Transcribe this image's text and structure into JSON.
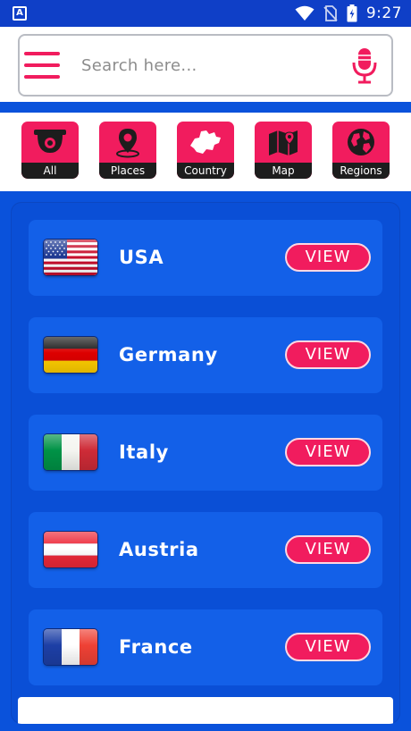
{
  "status_bar": {
    "app_badge": "A",
    "time": "9:27"
  },
  "search": {
    "placeholder": "Search here...",
    "value": ""
  },
  "categories": [
    {
      "label": "All",
      "icon": "cctv-camera-icon"
    },
    {
      "label": "Places",
      "icon": "map-pin-icon"
    },
    {
      "label": "Country",
      "icon": "country-shape-icon"
    },
    {
      "label": "Map",
      "icon": "folded-map-icon"
    },
    {
      "label": "Regions",
      "icon": "globe-icon"
    }
  ],
  "countries": [
    {
      "name": "USA",
      "flag": "us-flag",
      "action": "VIEW"
    },
    {
      "name": "Germany",
      "flag": "germany-flag",
      "action": "VIEW"
    },
    {
      "name": "Italy",
      "flag": "italy-flag",
      "action": "VIEW"
    },
    {
      "name": "Austria",
      "flag": "austria-flag",
      "action": "VIEW"
    },
    {
      "name": "France",
      "flag": "france-flag",
      "action": "VIEW"
    }
  ],
  "colors": {
    "accent": "#f11c5e",
    "background": "#0a52db",
    "card": "#1360e8",
    "status_bar": "#0f3fc7"
  }
}
